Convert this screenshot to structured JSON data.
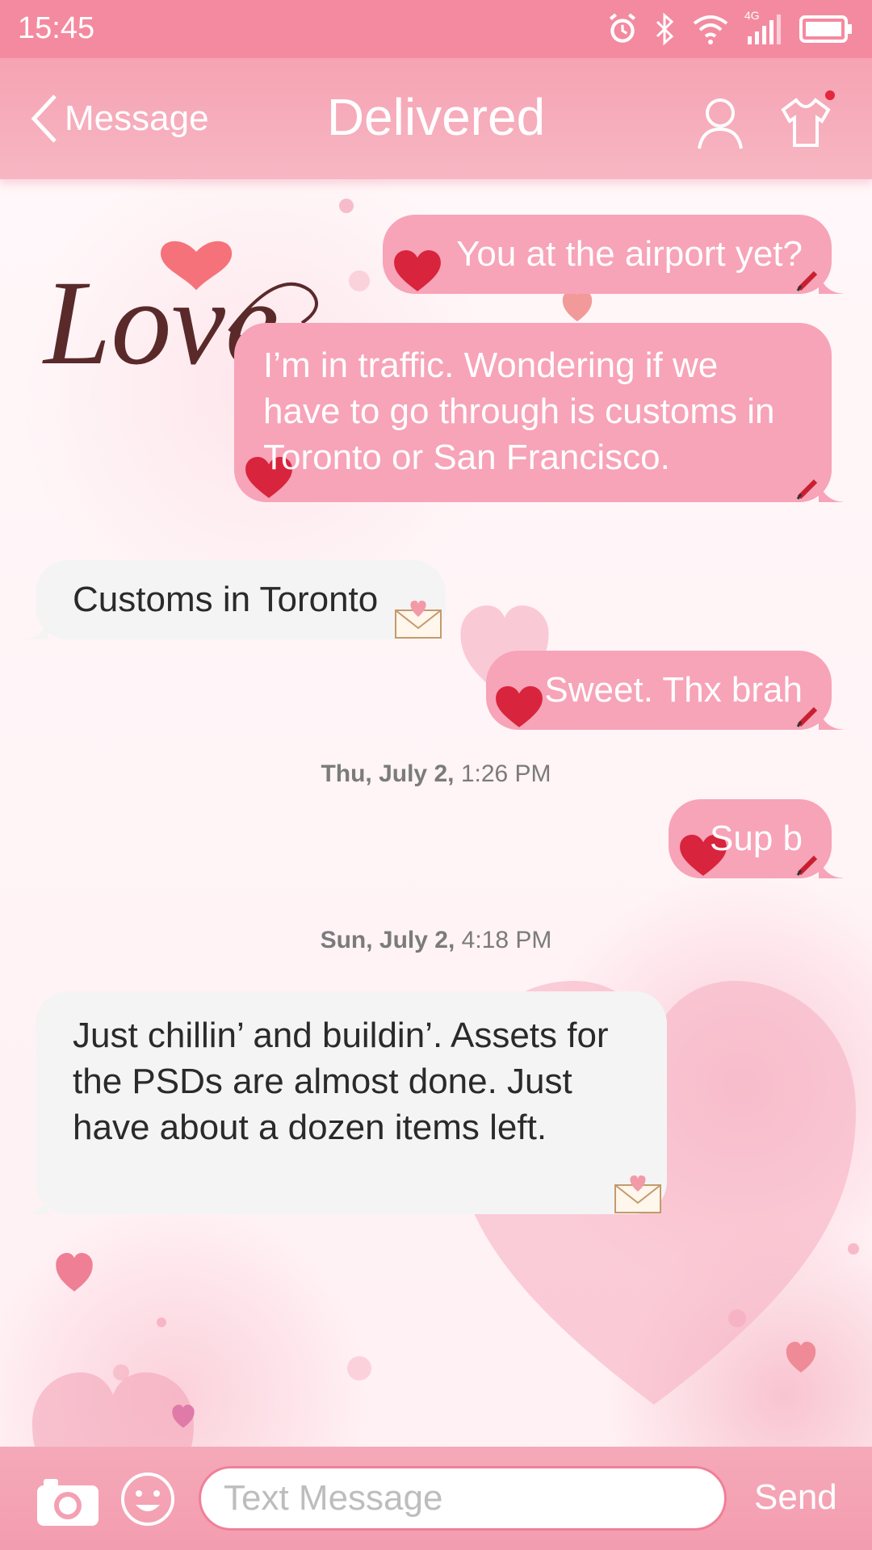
{
  "status_bar": {
    "time": "15:45",
    "network": "4G"
  },
  "header": {
    "back_label": "Message",
    "title": "Delivered"
  },
  "logo_text": "Love",
  "messages": [
    {
      "direction": "out",
      "text": "You at the airport yet?"
    },
    {
      "direction": "out",
      "text": "I’m in traffic. Wondering if we have to go through is customs in Toronto or San Francisco."
    },
    {
      "direction": "in",
      "text": "Customs in Toronto"
    },
    {
      "direction": "out",
      "text": "Sweet. Thx brah"
    },
    {
      "direction": "out",
      "text": "Sup b"
    },
    {
      "direction": "in",
      "text": "Just chillin’ and buildin’. Assets for the PSDs are almost done. Just have about a dozen items left."
    }
  ],
  "timestamps": [
    {
      "date": "Thu, July 2,",
      "time": "1:26 PM"
    },
    {
      "date": "Sun, July 2,",
      "time": "4:18 PM"
    }
  ],
  "composer": {
    "placeholder": "Text Message",
    "value": "",
    "send_label": "Send"
  },
  "colors": {
    "accent": "#f48aa0",
    "outgoing_bubble": "#f7a3b8",
    "incoming_bubble": "#f4f4f4"
  }
}
